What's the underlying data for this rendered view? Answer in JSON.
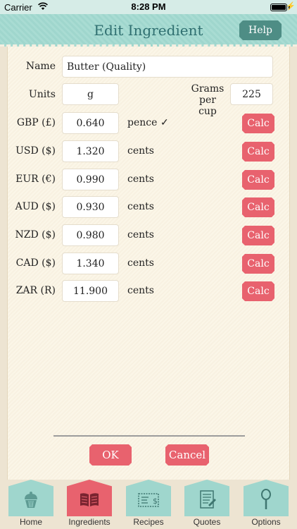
{
  "status_bar": {
    "carrier": "Carrier",
    "time": "8:28 PM"
  },
  "header": {
    "title": "Edit Ingredient",
    "help_label": "Help"
  },
  "form": {
    "name_label": "Name",
    "name_value": "Butter (Quality)",
    "units_label": "Units",
    "units_value": "g",
    "grams_label_line1": "Grams",
    "grams_label_line2": "per cup",
    "grams_value": "225",
    "calc_label": "Calc",
    "check_mark": "✓",
    "currencies": [
      {
        "label": "GBP (£)",
        "value": "0.640",
        "unit": "pence",
        "selected": true
      },
      {
        "label": "USD ($)",
        "value": "1.320",
        "unit": "cents"
      },
      {
        "label": "EUR (€)",
        "value": "0.990",
        "unit": "cents"
      },
      {
        "label": "AUD ($)",
        "value": "0.930",
        "unit": "cents"
      },
      {
        "label": "NZD ($)",
        "value": "0.980",
        "unit": "cents"
      },
      {
        "label": "CAD ($)",
        "value": "1.340",
        "unit": "cents"
      },
      {
        "label": "ZAR (R)",
        "value": "11.900",
        "unit": "cents"
      }
    ]
  },
  "actions": {
    "ok_label": "OK",
    "cancel_label": "Cancel"
  },
  "tabs": [
    {
      "label": "Home",
      "icon": "cupcake-icon"
    },
    {
      "label": "Ingredients",
      "icon": "book-icon",
      "active": true
    },
    {
      "label": "Recipes",
      "icon": "recipe-card-icon"
    },
    {
      "label": "Quotes",
      "icon": "quote-sheet-icon"
    },
    {
      "label": "Options",
      "icon": "spoon-icon"
    }
  ],
  "colors": {
    "accent_pink": "#e8626e",
    "header_teal": "#9fd6cd",
    "help_teal": "#4e8d85",
    "title_teal": "#2f6f70"
  }
}
